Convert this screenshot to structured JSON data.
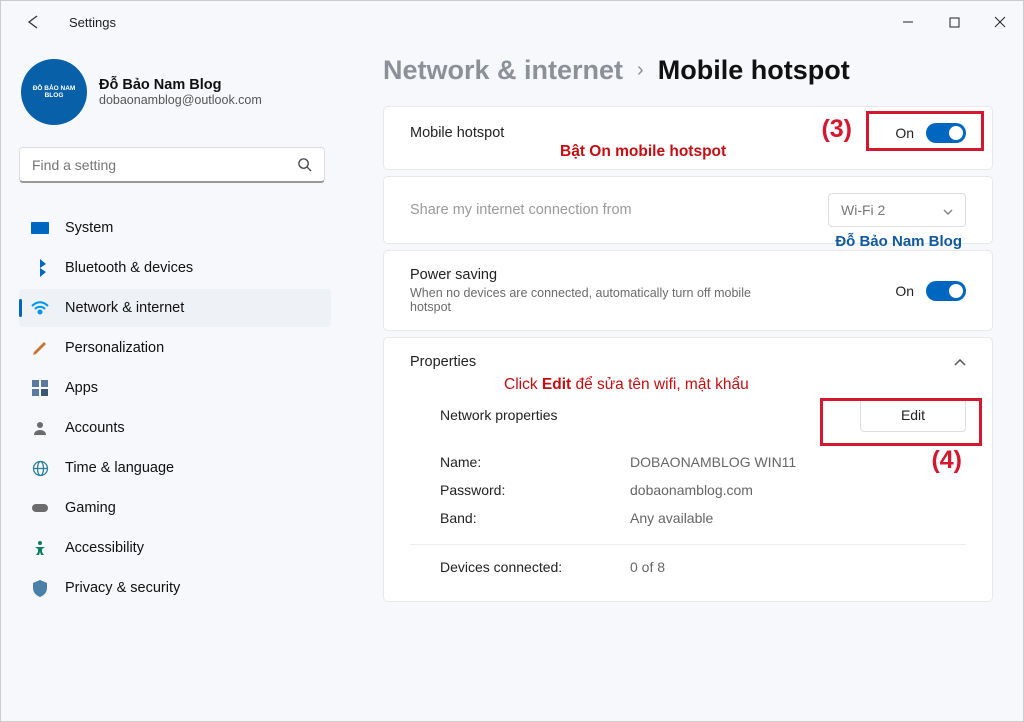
{
  "app": {
    "title": "Settings"
  },
  "profile": {
    "name": "Đỗ Bảo Nam Blog",
    "email": "dobaonamblog@outlook.com",
    "avatar_text": "ĐỖ BẢO NAM BLOG"
  },
  "search": {
    "placeholder": "Find a setting"
  },
  "nav": [
    {
      "label": "System"
    },
    {
      "label": "Bluetooth & devices"
    },
    {
      "label": "Network & internet"
    },
    {
      "label": "Personalization"
    },
    {
      "label": "Apps"
    },
    {
      "label": "Accounts"
    },
    {
      "label": "Time & language"
    },
    {
      "label": "Gaming"
    },
    {
      "label": "Accessibility"
    },
    {
      "label": "Privacy & security"
    }
  ],
  "breadcrumb": {
    "parent": "Network & internet",
    "sep": "›",
    "current": "Mobile hotspot"
  },
  "hotspot": {
    "title": "Mobile hotspot",
    "state_label": "On"
  },
  "share": {
    "title": "Share my internet connection from",
    "value": "Wi-Fi 2"
  },
  "power": {
    "title": "Power saving",
    "sub": "When no devices are connected, automatically turn off mobile hotspot",
    "state_label": "On"
  },
  "properties": {
    "header": "Properties",
    "network_properties": "Network properties",
    "edit": "Edit",
    "name_label": "Name:",
    "name_value": "DOBAONAMBLOG WIN11",
    "password_label": "Password:",
    "password_value": "dobaonamblog.com",
    "band_label": "Band:",
    "band_value": "Any available",
    "devices_label": "Devices connected:",
    "devices_value": "0 of 8"
  },
  "annotations": {
    "step3": "(3)",
    "step3_text": "Bật On mobile hotspot",
    "step4": "(4)",
    "step4_text_pre": "Click ",
    "step4_text_bold": "Edit",
    "step4_text_post": " để sửa tên wifi, mật khẩu",
    "watermark": "Đỗ Bảo Nam Blog"
  }
}
